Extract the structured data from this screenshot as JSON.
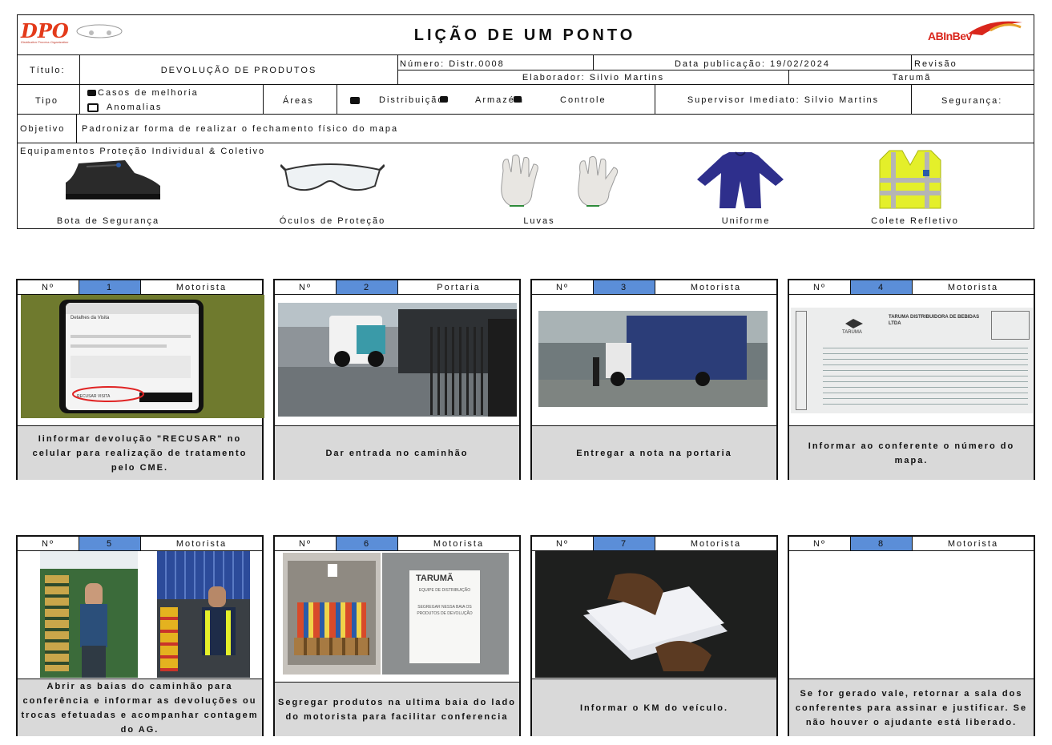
{
  "header": {
    "logo_left": "DPO",
    "logo_left_sub": "Distribution Process Organization",
    "title": "LIÇÃO DE UM PONTO",
    "logo_right": "ABInBev"
  },
  "form": {
    "titulo_label": "Título:",
    "titulo_value": "DEVOLUÇÃO DE PRODUTOS",
    "numero": "Número: Distr.0008",
    "data_publicacao": "Data publicação: 19/02/2024",
    "revisao": "Revisão",
    "elaborador": "Elaborador: Silvio Martins",
    "unidade": "Tarumã",
    "tipo_label": "Tipo",
    "tipo_opt1": "Casos de melhoria",
    "tipo_opt2": "Anomalias",
    "areas_label": "Áreas",
    "area1": "Distribuição",
    "area2": "Armazém",
    "area3": "Controle",
    "supervisor": "Supervisor Imediato: Silvio Martins",
    "seguranca": "Segurança:",
    "objetivo_label": "Objetivo",
    "objetivo_value": "Padronizar forma de realizar o fechamento físico do mapa",
    "epi_title": "Equipamentos Proteção Individual & Coletivo"
  },
  "ppe": [
    "Bota de Segurança",
    "Óculos de Proteção",
    "Luvas",
    "Uniforme",
    "Colete Refletivo"
  ],
  "steps": [
    {
      "no_label": "Nº",
      "num": "1",
      "role": "Motorista",
      "text": "Iinformar devolução \"RECUSAR\" no celular para realização de tratamento pelo CME."
    },
    {
      "no_label": "Nº",
      "num": "2",
      "role": "Portaria",
      "text": "Dar entrada no caminhão"
    },
    {
      "no_label": "Nº",
      "num": "3",
      "role": "Motorista",
      "text": "Entregar a nota na portaria"
    },
    {
      "no_label": "Nº",
      "num": "4",
      "role": "Motorista",
      "text": "Informar ao conferente o número do mapa."
    },
    {
      "no_label": "Nº",
      "num": "5",
      "role": "Motorista",
      "text": "Abrir as baias do caminhão para conferência e informar as devoluções ou trocas efetuadas e acompanhar contagem do AG."
    },
    {
      "no_label": "Nº",
      "num": "6",
      "role": "Motorista",
      "text": "Segregar produtos na ultima baia do lado do motorista para facilitar conferencia"
    },
    {
      "no_label": "Nº",
      "num": "7",
      "role": "Motorista",
      "text": "Informar o KM do veículo."
    },
    {
      "no_label": "Nº",
      "num": "8",
      "role": "Motorista",
      "text": "Se for gerado vale, retornar a sala dos conferentes para assinar e justificar. Se não houver o ajudante está liberado."
    }
  ],
  "photo_text": {
    "phone_button": "RECUSAR VISITA",
    "phone_title": "Detalhes da Visita",
    "doc_company": "TARUMA DISTRIBUIDORA DE BEBIDAS LTDA",
    "doc_brand": "TARUMA",
    "sign_brand": "TARUMÃ",
    "sign_sub": "EQUIPE DE DISTRIBUIÇÃO",
    "sign_text": "SEGREGAR NESSA BAIA OS PRODUTOS DE DEVOLUÇÃO"
  }
}
